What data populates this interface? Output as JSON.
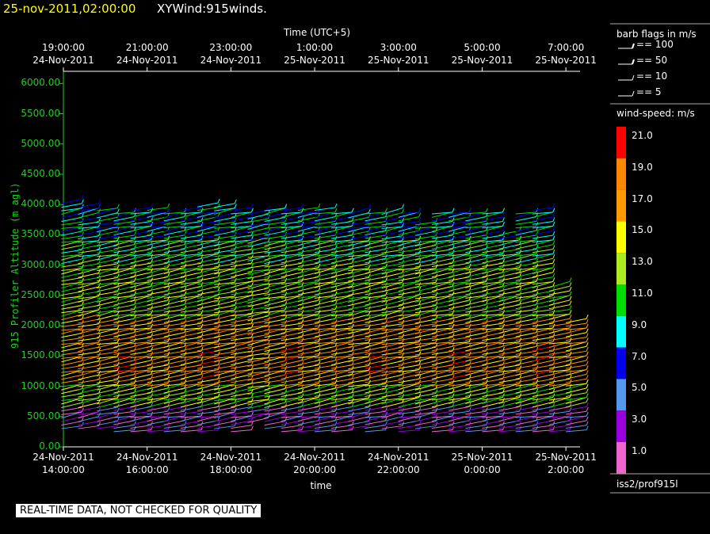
{
  "header": {
    "time": "25-nov-2011,02:00:00",
    "title": "XYWind:915winds."
  },
  "chart_data": {
    "type": "wind-barb",
    "top_axis_title": "Time (UTC+5)",
    "top_ticks": [
      [
        "19:00:00",
        "24-Nov-2011"
      ],
      [
        "21:00:00",
        "24-Nov-2011"
      ],
      [
        "23:00:00",
        "24-Nov-2011"
      ],
      [
        "1:00:00",
        "25-Nov-2011"
      ],
      [
        "3:00:00",
        "25-Nov-2011"
      ],
      [
        "5:00:00",
        "25-Nov-2011"
      ],
      [
        "7:00:00",
        "25-Nov-2011"
      ]
    ],
    "bottom_axis_title": "time",
    "bottom_ticks": [
      [
        "24-Nov-2011",
        "14:00:00"
      ],
      [
        "24-Nov-2011",
        "16:00:00"
      ],
      [
        "24-Nov-2011",
        "18:00:00"
      ],
      [
        "24-Nov-2011",
        "20:00:00"
      ],
      [
        "24-Nov-2011",
        "22:00:00"
      ],
      [
        "25-Nov-2011",
        "0:00:00"
      ],
      [
        "25-Nov-2011",
        "2:00:00"
      ]
    ],
    "ylabel": "915 Profiler Altitude (m agl)",
    "ylim": [
      0,
      6200
    ],
    "y_ticks": [
      "0.00",
      "500.00",
      "1000.00",
      "1500.00",
      "2000.00",
      "2500.00",
      "3000.00",
      "3500.00",
      "4000.00",
      "4500.00",
      "5000.00",
      "5500.00",
      "6000.00"
    ],
    "profile_hours": [
      13.95,
      14.35,
      14.8,
      15.2,
      15.6,
      16.0,
      16.4,
      16.8,
      17.2,
      17.6,
      18.0,
      18.4,
      18.8,
      19.2,
      19.6,
      20.0,
      20.4,
      20.8,
      21.2,
      21.6,
      22.0,
      22.4,
      22.8,
      23.2,
      23.6,
      24.0,
      24.4,
      24.8,
      25.2,
      25.6,
      26.0
    ],
    "top_alt_m": [
      4050,
      4000,
      3950,
      3900,
      3950,
      3920,
      3900,
      3950,
      3970,
      3960,
      3950,
      3850,
      3900,
      3950,
      3950,
      3930,
      3900,
      3870,
      3850,
      3870,
      3850,
      3700,
      3900,
      3880,
      3900,
      3850,
      3500,
      3900,
      3920,
      2650,
      2050
    ],
    "bottom_alt_m": [
      300,
      300,
      300,
      250,
      250,
      250,
      250,
      250,
      250,
      300,
      250,
      400,
      300,
      250,
      250,
      250,
      250,
      300,
      250,
      300,
      250,
      300,
      250,
      250,
      250,
      250,
      250,
      250,
      250,
      250,
      250
    ]
  },
  "legend": {
    "barb_title": "barb flags in m/s",
    "barbs": [
      "== 100",
      "== 50",
      "== 10",
      "== 5"
    ],
    "speed_title": "wind-speed: m/s",
    "speed_labels": [
      "21.0",
      "19.0",
      "17.0",
      "15.0",
      "13.0",
      "11.0",
      "9.0",
      "7.0",
      "5.0",
      "3.0",
      "1.0"
    ],
    "speed_colors": [
      "#ff0000",
      "#ff8800",
      "#ff9900",
      "#ffff00",
      "#aaee22",
      "#00dd00",
      "#00ffff",
      "#0000ee",
      "#5599ee",
      "#9900dd",
      "#ee66cc"
    ],
    "source": "iss2/prof915l"
  },
  "footer": {
    "quality": "REAL-TIME DATA, NOT CHECKED FOR QUALITY"
  }
}
